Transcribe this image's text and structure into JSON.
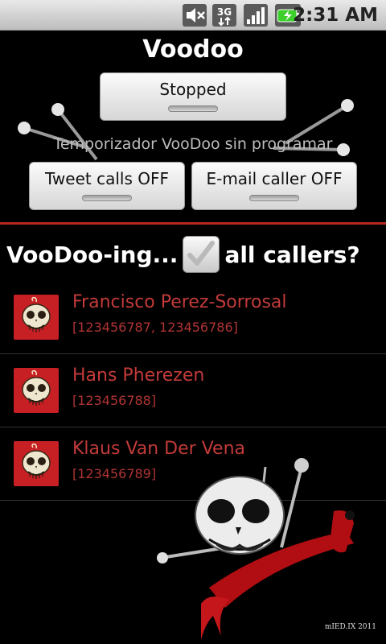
{
  "statusbar": {
    "time": "2:31 AM",
    "icons": [
      "mute-icon",
      "3g-icon",
      "signal-icon",
      "battery-charging-icon"
    ],
    "network_label": "3G"
  },
  "header": {
    "title": "Voodoo",
    "status_button": "Stopped",
    "timer_text": "Temporizador VooDoo sin programar",
    "tweet_button": "Tweet calls OFF",
    "email_button": "E-mail caller OFF"
  },
  "question": {
    "prefix": "VooDoo-ing...",
    "suffix": "all callers?",
    "checked": true
  },
  "callers": [
    {
      "name": "Francisco Perez-Sorrosal",
      "numbers": "[123456787, 123456786]"
    },
    {
      "name": "Hans Pherezen",
      "numbers": "[123456788]"
    },
    {
      "name": "Klaus Van Der Vena",
      "numbers": "[123456789]"
    }
  ],
  "colors": {
    "accent": "#b7281f",
    "caller_text": "#c23a3a",
    "avatar_bg": "#c61f24"
  },
  "credit": "mIED.IX 2011"
}
